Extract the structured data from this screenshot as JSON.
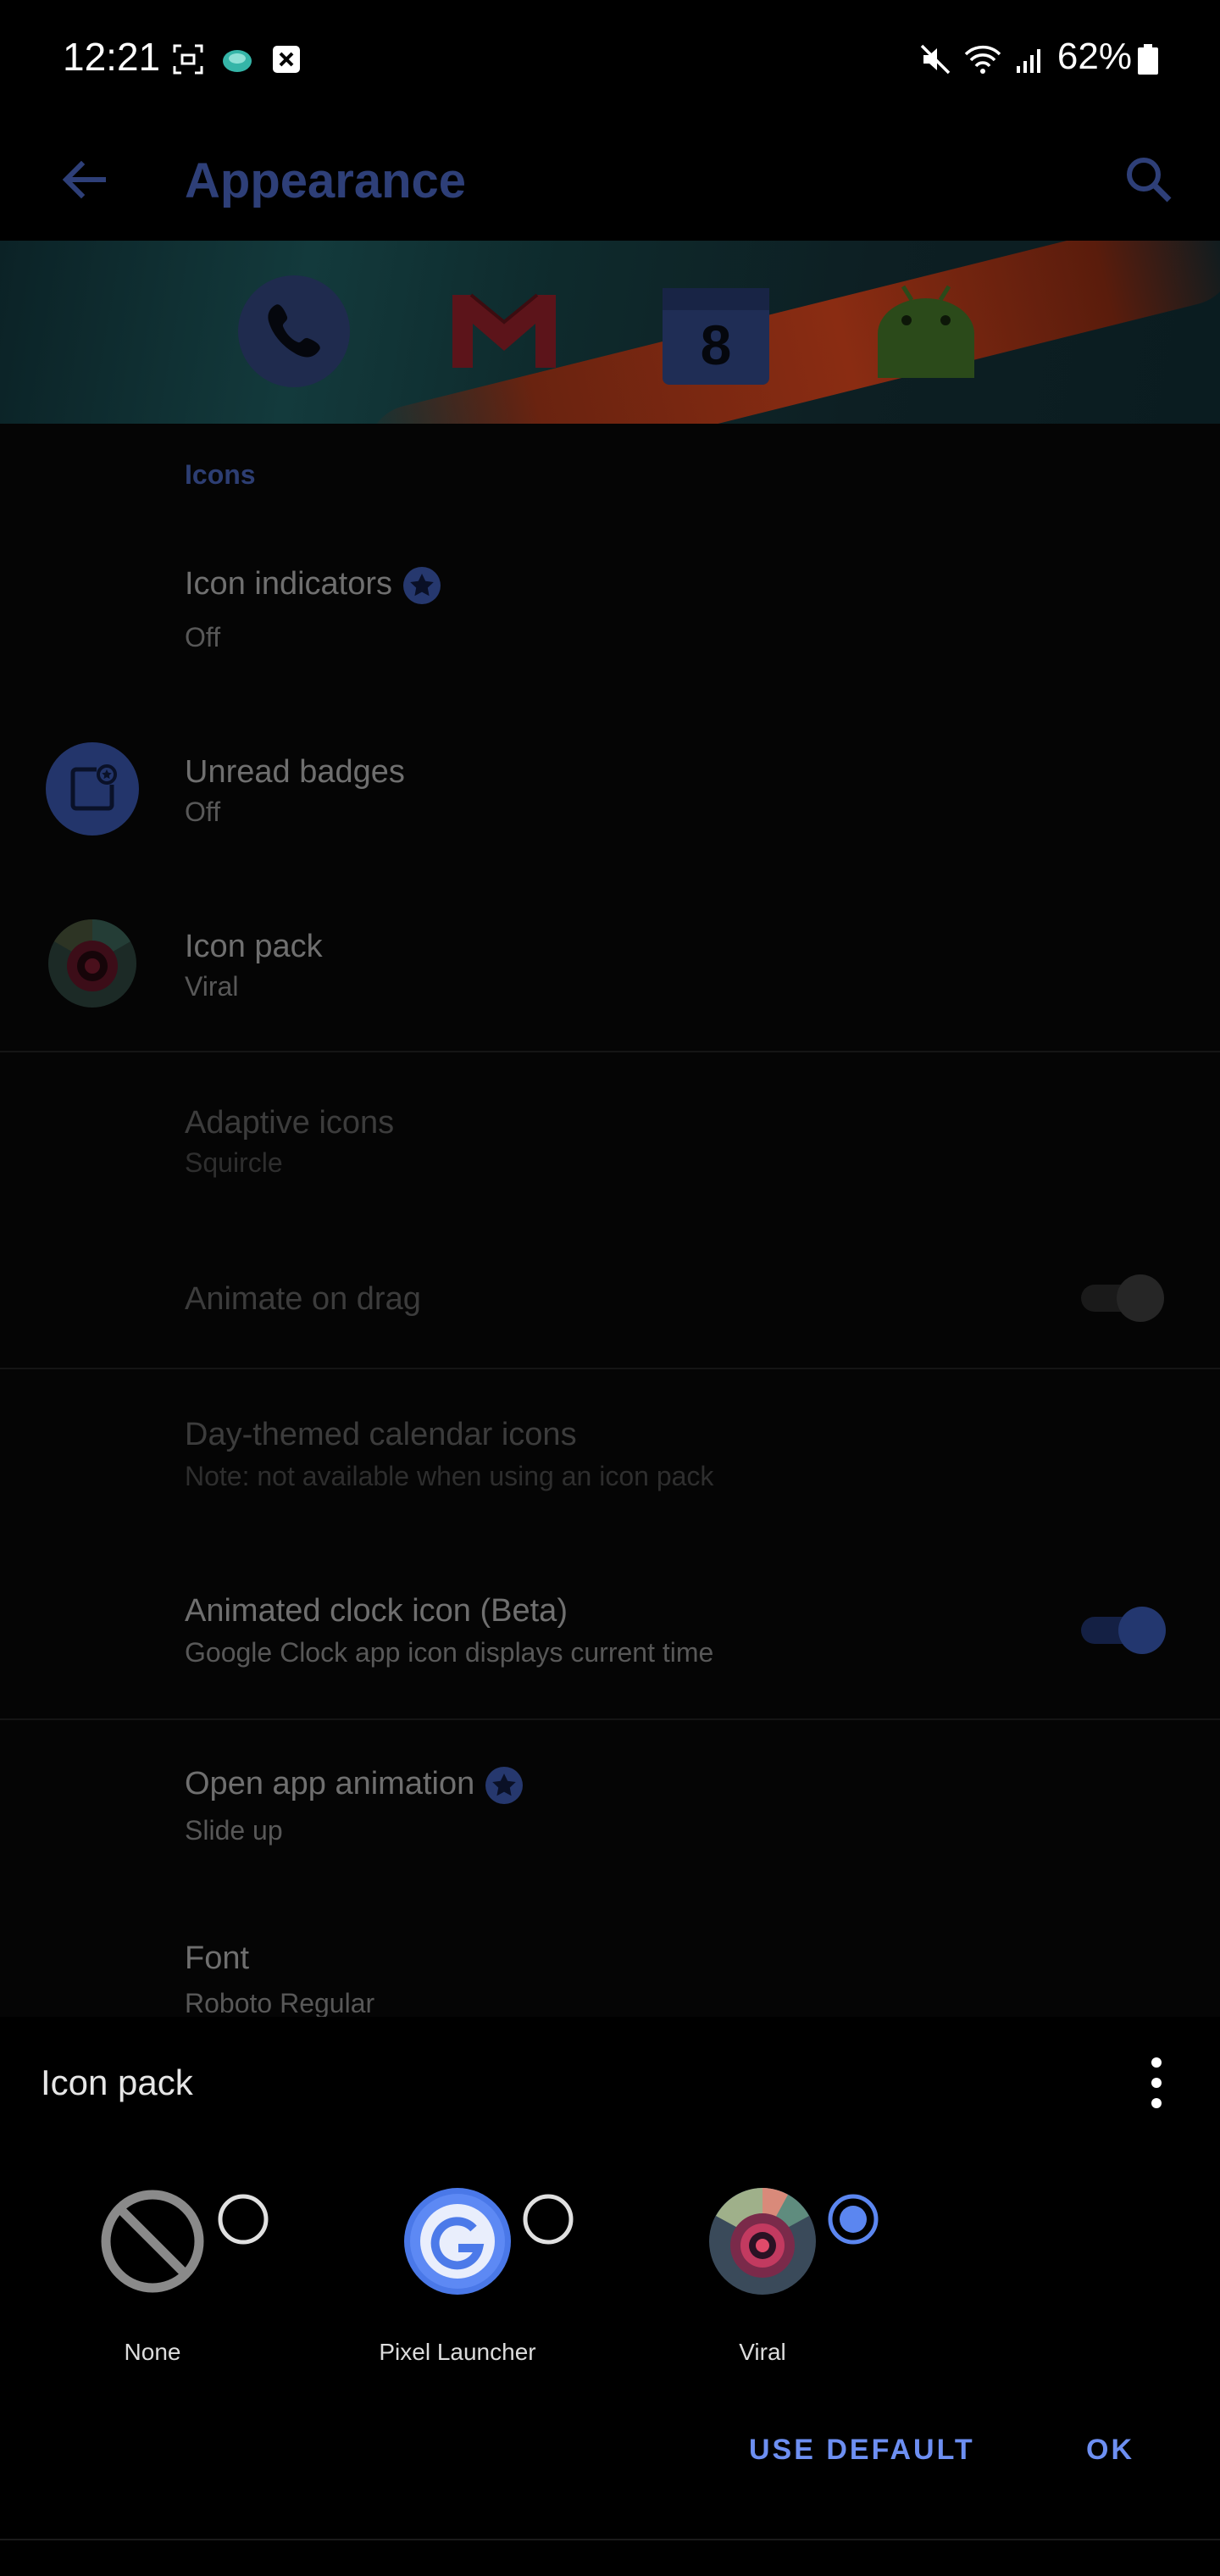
{
  "status_bar": {
    "time": "12:21",
    "battery": "62%",
    "left_icons": [
      "screenshot-icon",
      "app-notification-icon",
      "close-box-icon"
    ],
    "right_icons": [
      "mute-icon",
      "wifi-icon",
      "signal-icon",
      "battery-icon"
    ]
  },
  "appbar": {
    "title": "Appearance",
    "back_icon": "arrow-back-icon",
    "search_icon": "search-icon"
  },
  "banner": {
    "icons": [
      "phone-icon",
      "gmail-icon",
      "calendar-icon",
      "android-icon"
    ],
    "calendar_day": "8"
  },
  "settings": {
    "section_header": "Icons",
    "icon_indicators": {
      "title": "Icon indicators",
      "subtitle": "Off"
    },
    "unread_badges": {
      "title": "Unread badges",
      "subtitle": "Off"
    },
    "icon_pack": {
      "title": "Icon pack",
      "subtitle": "Viral"
    },
    "adaptive_icons": {
      "title": "Adaptive icons",
      "subtitle": "Squircle"
    },
    "animate_on_drag": {
      "title": "Animate on drag",
      "enabled": false
    },
    "day_themed_calendar": {
      "title": "Day-themed calendar icons",
      "subtitle": "Note: not available when using an icon pack"
    },
    "animated_clock": {
      "title": "Animated clock icon (Beta)",
      "subtitle": "Google Clock app icon displays current time",
      "enabled": true
    },
    "open_app_animation": {
      "title": "Open app animation",
      "subtitle": "Slide up"
    },
    "font": {
      "title": "Font",
      "subtitle": "Roboto Regular"
    }
  },
  "sheet": {
    "title": "Icon pack",
    "options": [
      {
        "label": "None",
        "selected": false
      },
      {
        "label": "Pixel Launcher",
        "selected": false
      },
      {
        "label": "Viral",
        "selected": true
      }
    ],
    "use_default": "USE DEFAULT",
    "ok": "OK"
  },
  "colors": {
    "accent": "#6d8ff2",
    "radio_selected": "#5b86f0",
    "dim_title": "#2e3f78"
  }
}
